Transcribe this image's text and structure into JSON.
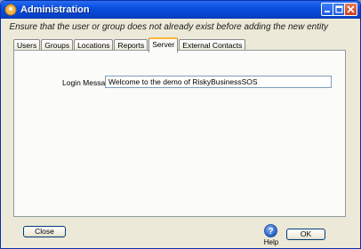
{
  "window": {
    "title": "Administration"
  },
  "hint": "Ensure that the user or group does not already exist before adding the new entity",
  "tabs": [
    {
      "label": "Users",
      "active": false
    },
    {
      "label": "Groups",
      "active": false
    },
    {
      "label": "Locations",
      "active": false
    },
    {
      "label": "Reports",
      "active": false
    },
    {
      "label": "Server",
      "active": true
    },
    {
      "label": "External Contacts",
      "active": false
    }
  ],
  "server": {
    "login_label": "Login Message:",
    "login_value": "Welcome to the demo of RiskyBusinessSOS"
  },
  "footer": {
    "close_label": "Close",
    "help_label": "Help",
    "ok_label": "OK"
  },
  "colors": {
    "titlebar": "#0a52e0",
    "active_tab_accent": "#ffb43a",
    "help_icon": "#2f6ed6"
  },
  "icons": {
    "app": "app-icon",
    "minimize": "minimize-icon",
    "maximize": "maximize-icon",
    "close": "close-icon",
    "help": "question-icon"
  }
}
